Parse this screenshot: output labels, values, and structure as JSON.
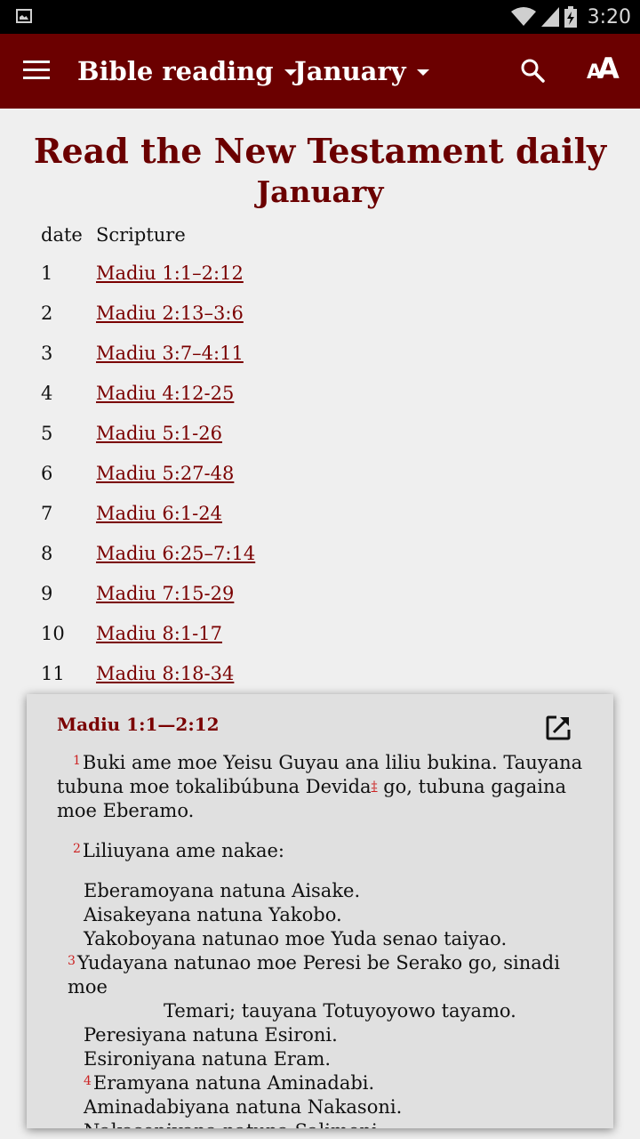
{
  "status_bar": {
    "time": "3:20",
    "icons": [
      "image-notification-icon",
      "wifi-icon",
      "cell-signal-icon",
      "battery-charging-icon"
    ]
  },
  "app_bar": {
    "menu_icon": "hamburger-menu-icon",
    "book_selector": "Bible reading",
    "month_selector": "January",
    "search_icon": "search-icon",
    "font_icon": "font-size-icon",
    "font_small": "A",
    "font_big": "A",
    "background_color": "#6b0000"
  },
  "page": {
    "title": "Read the New Testament daily",
    "subtitle": "January",
    "table": {
      "headers": [
        "date",
        "Scripture"
      ],
      "rows": [
        {
          "date": "1",
          "scripture": "Madiu 1:1–2:12"
        },
        {
          "date": "2",
          "scripture": "Madiu 2:13–3:6"
        },
        {
          "date": "3",
          "scripture": "Madiu 3:7–4:11"
        },
        {
          "date": "4",
          "scripture": "Madiu 4:12-25"
        },
        {
          "date": "5",
          "scripture": "Madiu 5:1-26"
        },
        {
          "date": "6",
          "scripture": "Madiu 5:27-48"
        },
        {
          "date": "7",
          "scripture": "Madiu 6:1-24"
        },
        {
          "date": "8",
          "scripture": "Madiu 6:25–7:14"
        },
        {
          "date": "9",
          "scripture": "Madiu 7:15-29"
        },
        {
          "date": "10",
          "scripture": "Madiu 8:1-17"
        },
        {
          "date": "11",
          "scripture": "Madiu 8:18-34"
        }
      ]
    }
  },
  "popup": {
    "title": "Madiu 1:1—2:12",
    "open_icon": "open-external-icon",
    "verse1_num": "1",
    "verse1_text_a": "Buki ame moe Yeisu Guyau ana liliu bukina. Tauyana tubuna moe tokalibúbuna Devida",
    "footnote_marker": "‡",
    "verse1_text_b": " go, tubuna gagaina moe Eberamo.",
    "verse2_num": "2",
    "verse2_text": "Liliuyana ame nakae:",
    "poetry": [
      {
        "num": "",
        "text": "Eberamoyana natuna Aisake."
      },
      {
        "num": "",
        "text": "Aisakeyana natuna Yakobo."
      },
      {
        "num": "",
        "text": "Yakoboyana natunao moe Yuda senao taiyao."
      },
      {
        "num": "3",
        "text": "Yudayana natunao moe Peresi be Serako go, sinadi moe"
      },
      {
        "num": "",
        "text": "Temari; tauyana Totuyoyowo tayamo.",
        "continuation": true
      },
      {
        "num": "",
        "text": "Peresiyana natuna Esironi."
      },
      {
        "num": "",
        "text": "Esironiyana natuna Eram."
      },
      {
        "num": "4",
        "text": "Eramyana natuna Aminadabi."
      },
      {
        "num": "",
        "text": "Aminadabiyana natuna Nakasoni."
      },
      {
        "num": "",
        "text": "Nakasoniyana natuna Salimoni."
      }
    ]
  }
}
